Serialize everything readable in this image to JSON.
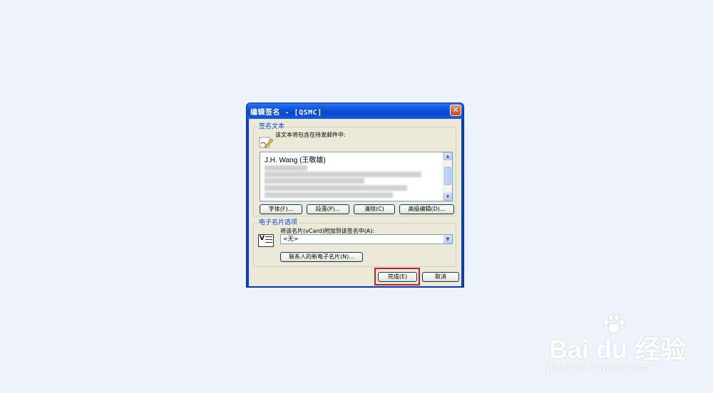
{
  "dialog": {
    "title": "编辑签名 - [QSMC]",
    "close_label": "✕"
  },
  "signature_group": {
    "title": "签名文本",
    "description": "该文本将包含在待发邮件中:",
    "first_line": "J.H. Wang (王敬雄)",
    "buttons": {
      "font": "字体(F)...",
      "paragraph": "段落(P)...",
      "clear": "清除(C)",
      "advanced": "高级编辑(D)..."
    }
  },
  "vcard_group": {
    "title": "电子名片选项",
    "attach_label": "将该名片(vCard)附加到该签名中(A):",
    "selected_value": "<无>",
    "new_card_button": "联系人的新电子名片(N)..."
  },
  "footer": {
    "ok_label": "完成(E)",
    "cancel_label": "取消"
  },
  "colors": {
    "highlight": "#c8221c",
    "group_title": "#0046d5"
  },
  "watermark": {
    "brand": "Bai du 经验",
    "sub": "jingyan.baidu.com"
  }
}
